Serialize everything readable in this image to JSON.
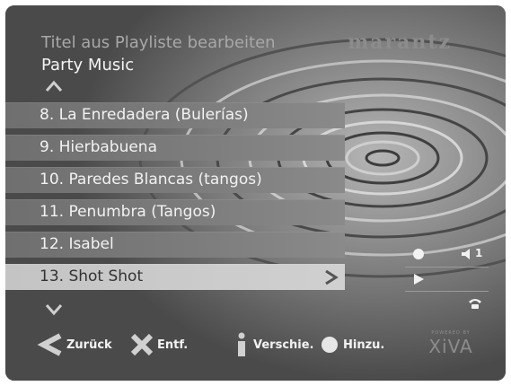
{
  "header": {
    "title": "Titel aus Playliste bearbeiten",
    "playlist_name": "Party Music",
    "brand": "marantz"
  },
  "tracks": [
    {
      "label": "8. La Enredadera (Bulerías)"
    },
    {
      "label": "9. Hierbabuena"
    },
    {
      "label": "10. Paredes Blancas (tangos)"
    },
    {
      "label": "11. Penumbra (Tangos)"
    },
    {
      "label": "12. Isabel"
    },
    {
      "label": "13. Shot Shot",
      "selected": true
    }
  ],
  "status": {
    "volume_level": "1"
  },
  "footer": {
    "back_label": "Zurück",
    "delete_label": "Entf.",
    "move_label": "Verschie.",
    "add_label": "Hinzu."
  },
  "powered_by": {
    "small": "POWERED BY",
    "logo": "XiVA"
  },
  "colors": {
    "selected_row": "#c8c8c8",
    "row": "#7a7a7a",
    "text": "#f2f2f2",
    "dim_text": "#a8a8a8"
  }
}
